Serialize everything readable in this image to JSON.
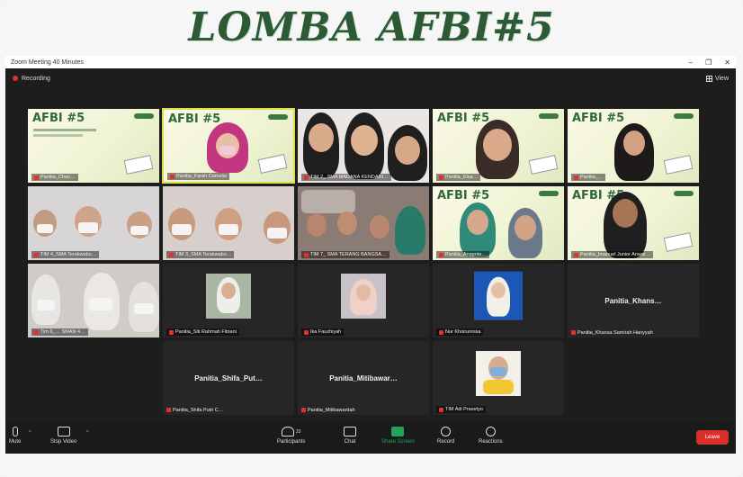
{
  "banner": {
    "title": "LOMBA AFBI#5"
  },
  "window": {
    "title": "Zoom Meeting 40 Minutes",
    "minimize": "–",
    "maximize": "❐",
    "close": "✕"
  },
  "topbar": {
    "recording": "Recording",
    "view": "View"
  },
  "slide_text": "AFBI #5",
  "tiles": [
    {
      "label": "Panitia_Chan…"
    },
    {
      "label": "Panitia_Farah Camalia"
    },
    {
      "label": "TIM 2_ SMA MADANA KENDARI…"
    },
    {
      "label": "Panitia_Elsa…"
    },
    {
      "label": "Panitia_…"
    },
    {
      "label": "TIM 4_SMA Terakwabo…"
    },
    {
      "label": "TIM 3_SMA Terakwabo…"
    },
    {
      "label": "TIM 7_ SMA TERANG BANGSA…"
    },
    {
      "label": "Panitia_Anggota…"
    },
    {
      "label": "Panitia_Imanuel Junior Anwar…"
    },
    {
      "label": "Tim 6_… SMAN 4…"
    },
    {
      "label": "Panitia_Siti Rahmah Fitriani"
    },
    {
      "label": "Ika Fauzhiyah"
    },
    {
      "label": "Nur Khoirunnisa"
    },
    {
      "label": "Panitia_Khansa Samirah Hanyyah"
    },
    {
      "label": "Panitia_Shifa Putri C…"
    },
    {
      "label": "Panitia_Mitibawardah"
    },
    {
      "label": "TIM Adi Prasetyo"
    }
  ],
  "name_tiles": {
    "khansa": "Panitia_Khans…",
    "shifa": "Panitia_Shifa_Put…",
    "mitibawar": "Panitia_Mitibawar…"
  },
  "toolbar": {
    "mute": "Mute",
    "stop_video": "Stop Video",
    "participants": "Participants",
    "participants_count": "33",
    "chat": "Chat",
    "share_screen": "Share Screen",
    "record": "Record",
    "reactions": "Reactions",
    "end": "Leave"
  },
  "colors": {
    "banner": "#2c5a35",
    "share": "#23a35a",
    "end": "#d9302b",
    "active_speaker": "#d9e04a"
  }
}
